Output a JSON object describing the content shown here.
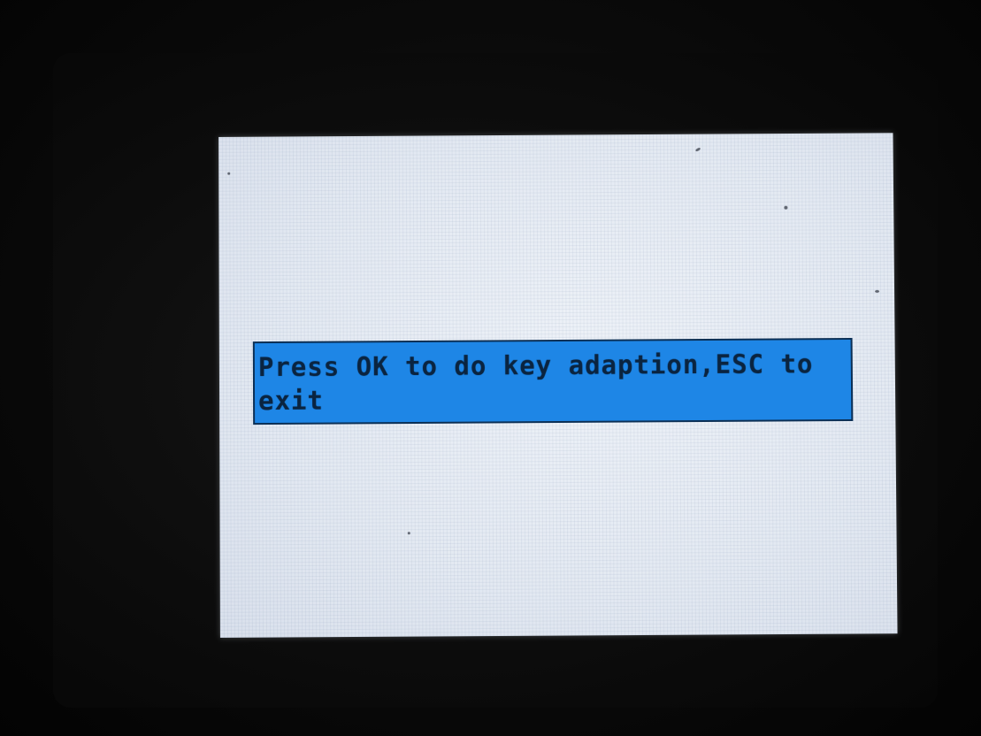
{
  "screen": {
    "message_line_1": "Press OK to do key adaption,ESC to",
    "message_line_2": "exit"
  },
  "colors": {
    "background": "#050505",
    "screen": "#e6ebf3",
    "banner": "#1e86e6",
    "banner_border": "#0b2f55",
    "text": "#0a2440"
  }
}
